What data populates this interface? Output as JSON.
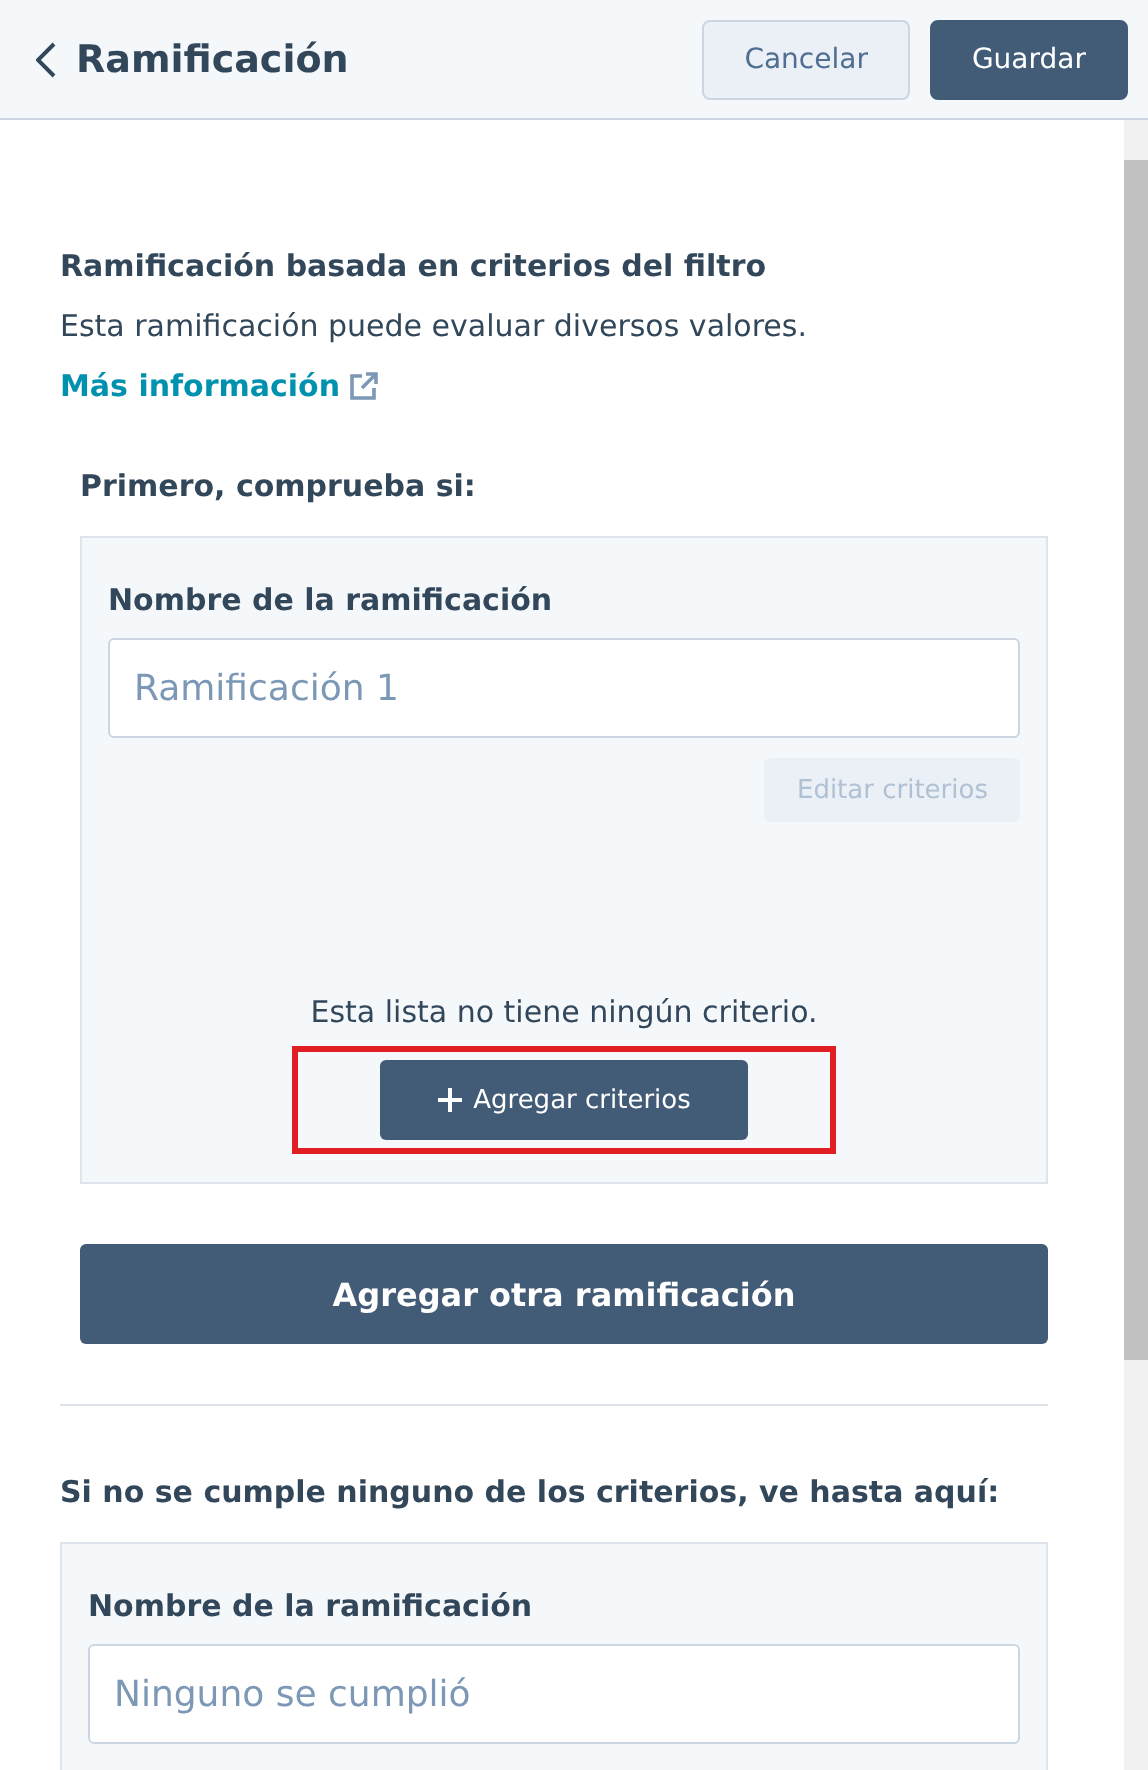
{
  "header": {
    "title": "Ramificación",
    "buttons": [
      {
        "label": "Cancelar",
        "kind": "secondary"
      },
      {
        "label": "Guardar",
        "kind": "primary"
      }
    ]
  },
  "section": {
    "heading": "Ramificación basada en criterios del filtro",
    "description": "Esta ramificación puede evaluar diversos valores.",
    "link": "Más información"
  },
  "first_check": {
    "label": "Primero, comprueba si:",
    "branch": {
      "name_label": "Nombre de la ramificación",
      "placeholder": "Ramificación 1",
      "edit_button": {
        "label": "Editar criterios",
        "disabled": true
      },
      "empty_text": "Esta lista no tiene ningún criterio.",
      "add_button": {
        "label": "Agregar criterios",
        "highlighted": true
      }
    }
  },
  "add_branch_button": "Agregar otra ramificación",
  "fallback": {
    "label": "Si no se cumple ninguno de los criterios, ve hasta aquí:",
    "name_label": "Nombre de la ramificación",
    "placeholder": "Ninguno se cumplió"
  }
}
